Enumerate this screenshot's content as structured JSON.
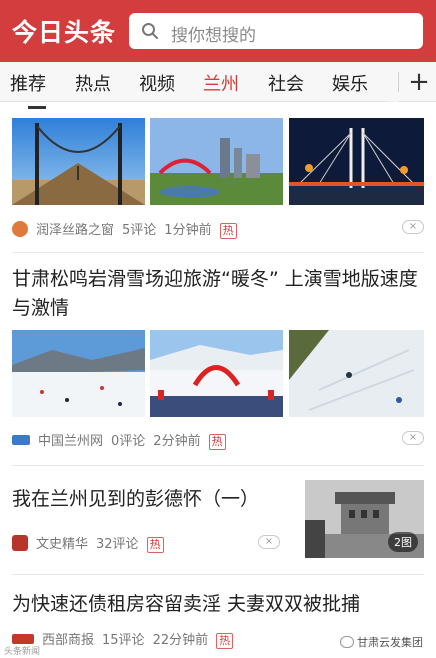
{
  "header": {
    "logo": "今日头条",
    "search_placeholder": "搜你想搜的"
  },
  "tabs": [
    {
      "label": "推荐",
      "active": false
    },
    {
      "label": "热点",
      "active": false
    },
    {
      "label": "视频",
      "active": false
    },
    {
      "label": "兰州",
      "active": true
    },
    {
      "label": "社会",
      "active": false
    },
    {
      "label": "娱乐",
      "active": false
    }
  ],
  "add_tab": "+",
  "articles": [
    {
      "title": "",
      "source": "润泽丝路之窗",
      "comments": "5评论",
      "time": "1分钟前",
      "badge": "热",
      "dismiss": "×"
    },
    {
      "title": "甘肃松鸣岩滑雪场迎旅游“暖冬” 上演雪地版速度与激情",
      "source": "中国兰州网",
      "comments": "0评论",
      "time": "2分钟前",
      "badge": "热",
      "dismiss": "×"
    },
    {
      "title": "我在兰州见到的彭德怀（一）",
      "source": "文史精华",
      "comments": "32评论",
      "badge": "热",
      "dismiss": "×",
      "image_count": "2图"
    },
    {
      "title": "为快速还债租房容留卖淫 夫妻双双被批捕",
      "source": "西部商报",
      "comments": "15评论",
      "time": "22分钟前",
      "badge": "热"
    }
  ],
  "watermarks": {
    "left": "头条新闻",
    "right": "甘肃云发集团"
  },
  "colors": {
    "brand_red": "#d43d3d",
    "meta_gray": "#777777",
    "divider": "#e8e8e8"
  }
}
